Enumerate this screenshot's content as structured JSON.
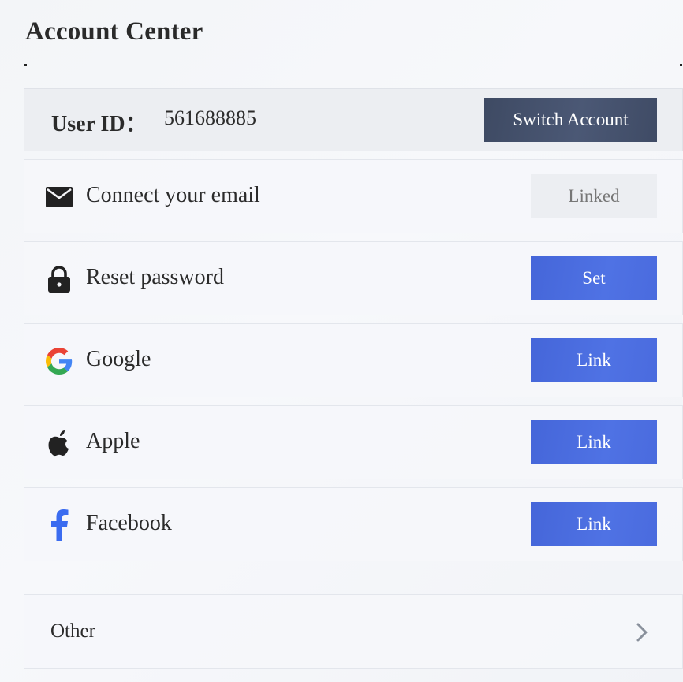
{
  "page": {
    "title": "Account Center"
  },
  "user": {
    "label": "User ID：",
    "id_value": "561688885",
    "switch_label": "Switch Account"
  },
  "items": [
    {
      "name": "email",
      "icon": "mail-icon",
      "label": "Connect your email",
      "action": "Linked"
    },
    {
      "name": "password",
      "icon": "lock-icon",
      "label": "Reset password",
      "action": "Set"
    },
    {
      "name": "google",
      "icon": "google-icon",
      "label": "Google",
      "action": "Link"
    },
    {
      "name": "apple",
      "icon": "apple-icon",
      "label": "Apple",
      "action": "Link"
    },
    {
      "name": "facebook",
      "icon": "facebook-icon",
      "label": "Facebook",
      "action": "Link"
    }
  ],
  "other": {
    "label": "Other",
    "icon": "chevron-right-icon"
  },
  "colors": {
    "primary_button": "#4a6bde",
    "dark_button": "#45526c",
    "linked_badge_bg": "#eceef2",
    "text": "#2b2b2b"
  }
}
